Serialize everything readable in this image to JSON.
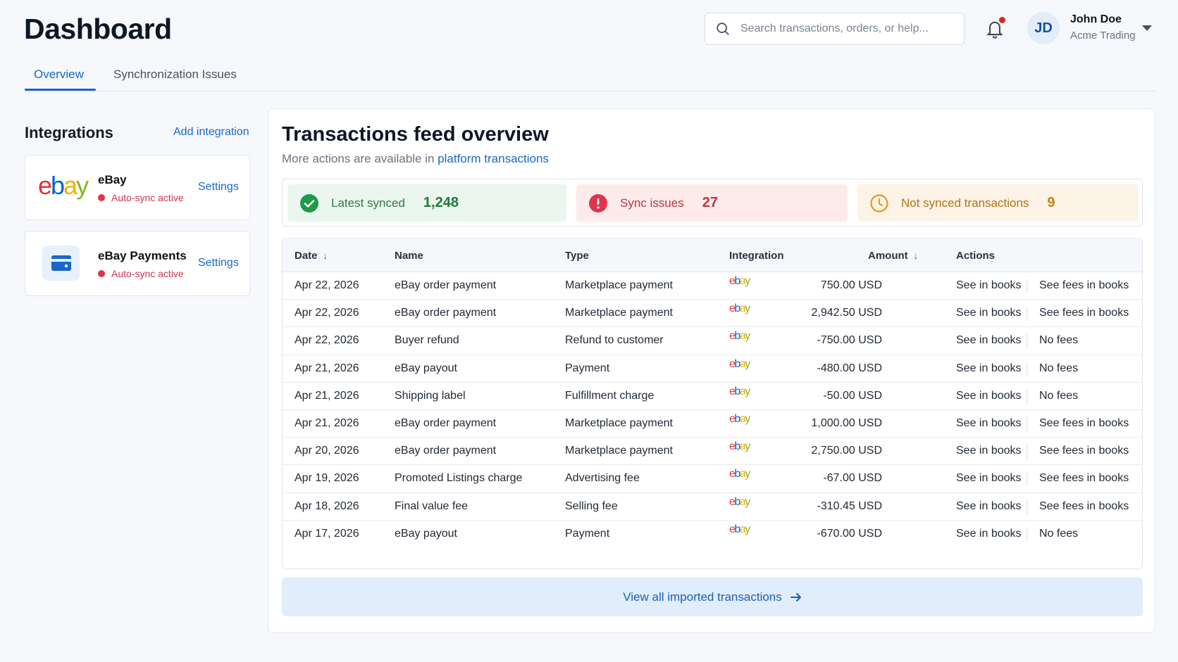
{
  "header": {
    "title": "Dashboard",
    "search_placeholder": "Search transactions, orders, or help...",
    "user": {
      "initials": "JD",
      "name": "John Doe",
      "org": "Acme Trading"
    }
  },
  "tabs": [
    {
      "label": "Overview",
      "active": true
    },
    {
      "label": "Synchronization Issues",
      "active": false
    }
  ],
  "sidebar": {
    "title": "Integrations",
    "add_label": "Add integration",
    "integrations": [
      {
        "name": "eBay",
        "status": "Auto-sync active",
        "settings_label": "Settings",
        "icon": "ebay-logo"
      },
      {
        "name": "eBay Payments",
        "status": "Auto-sync active",
        "settings_label": "Settings",
        "icon": "credit-card-icon"
      }
    ]
  },
  "main": {
    "title": "Transactions feed overview",
    "subtitle_prefix": "More actions are available in",
    "subtitle_link": "platform transactions",
    "stats": [
      {
        "label": "Latest synced",
        "value": "1,248",
        "color": "#1f7a3a"
      },
      {
        "label": "Sync issues",
        "value": "27",
        "color": "#c13245"
      },
      {
        "label": "Not synced transactions",
        "value": "9",
        "color": "#c8860d"
      }
    ],
    "columns": [
      "Date",
      "Name",
      "Type",
      "Integration",
      "Amount",
      "Actions"
    ],
    "sort_arrow": "↓",
    "rows": [
      {
        "date": "Apr 22, 2026",
        "name": "eBay order payment",
        "type": "Marketplace payment",
        "amount": "750.00 USD",
        "action1": "See in books",
        "action2": "See fees in books",
        "action2_link": true
      },
      {
        "date": "Apr 22, 2026",
        "name": "eBay order payment",
        "type": "Marketplace payment",
        "amount": "2,942.50 USD",
        "action1": "See in books",
        "action2": "See fees in books",
        "action2_link": true
      },
      {
        "date": "Apr 22, 2026",
        "name": "Buyer refund",
        "type": "Refund to customer",
        "amount": "-750.00 USD",
        "action1": "See in books",
        "action2": "No fees",
        "action2_link": false
      },
      {
        "date": "Apr 21, 2026",
        "name": "eBay payout",
        "type": "Payment",
        "amount": "-480.00 USD",
        "action1": "See in books",
        "action2": "No fees",
        "action2_link": false
      },
      {
        "date": "Apr 21, 2026",
        "name": "Shipping label",
        "type": "Fulfillment charge",
        "amount": "-50.00 USD",
        "action1": "See in books",
        "action2": "No fees",
        "action2_link": false
      },
      {
        "date": "Apr 21, 2026",
        "name": "eBay order payment",
        "type": "Marketplace payment",
        "amount": "1,000.00 USD",
        "action1": "See in books",
        "action2": "See fees in books",
        "action2_link": true
      },
      {
        "date": "Apr 20, 2026",
        "name": "eBay order payment",
        "type": "Marketplace payment",
        "amount": "2,750.00 USD",
        "action1": "See in books",
        "action2": "See fees in books",
        "action2_link": true
      },
      {
        "date": "Apr 19, 2026",
        "name": "Promoted Listings charge",
        "type": "Advertising fee",
        "amount": "-67.00 USD",
        "action1": "See in books",
        "action2": "See fees in books",
        "action2_link": true
      },
      {
        "date": "Apr 18, 2026",
        "name": "Final value fee",
        "type": "Selling fee",
        "amount": "-310.45 USD",
        "action1": "See in books",
        "action2": "See fees in books",
        "action2_link": true
      },
      {
        "date": "Apr 17, 2026",
        "name": "eBay payout",
        "type": "Payment",
        "amount": "-670.00 USD",
        "action1": "See in books",
        "action2": "No fees",
        "action2_link": false
      }
    ],
    "view_all_label": "View all imported transactions"
  }
}
